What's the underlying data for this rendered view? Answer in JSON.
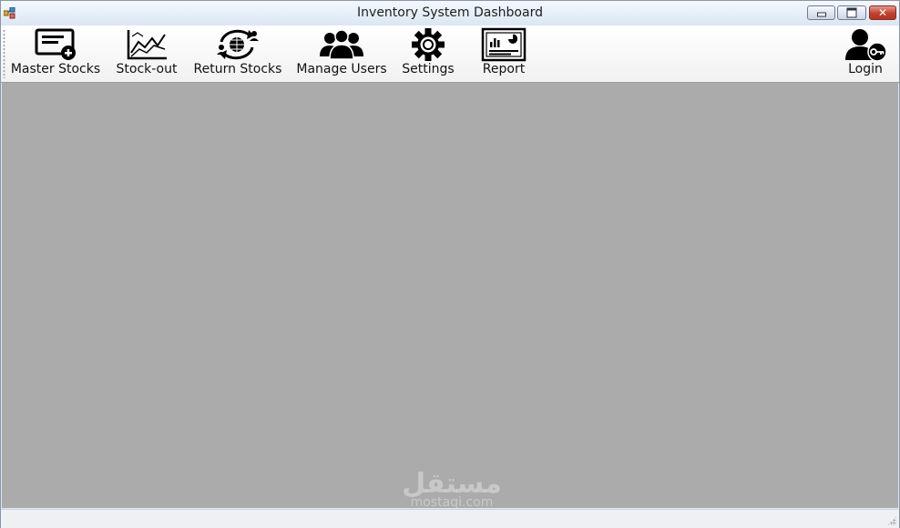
{
  "window": {
    "title": "Inventory System Dashboard"
  },
  "toolbar": {
    "items": [
      {
        "label": "Master Stocks",
        "icon": "add-document-icon"
      },
      {
        "label": "Stock-out",
        "icon": "line-chart-icon"
      },
      {
        "label": "Return Stocks",
        "icon": "exchange-globe-icon"
      },
      {
        "label": "Manage Users",
        "icon": "users-group-icon"
      },
      {
        "label": "Settings",
        "icon": "gear-icon"
      },
      {
        "label": "Report",
        "icon": "report-icon"
      },
      {
        "label": "Login",
        "icon": "user-key-icon"
      }
    ]
  },
  "watermark": {
    "arabic": "مستقل",
    "latin": "mostaqi.com"
  },
  "colors": {
    "client_background": "#ababab",
    "titlebar": "#dbe6f4",
    "close_button": "#c2402e"
  }
}
